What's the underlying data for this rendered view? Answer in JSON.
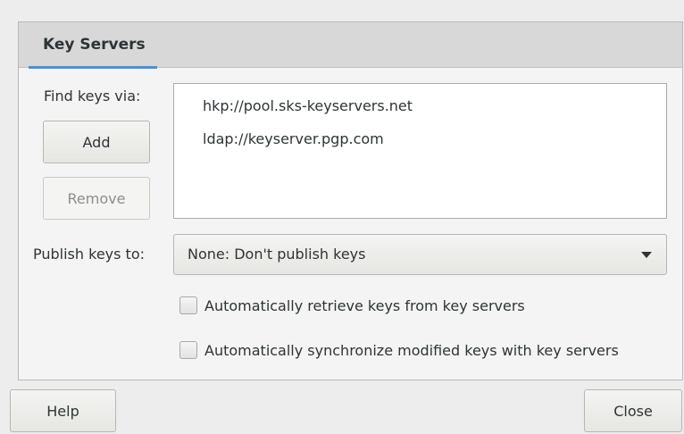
{
  "tab": {
    "label": "Key Servers"
  },
  "find_keys": {
    "label": "Find keys via:",
    "add_label": "Add",
    "remove_label": "Remove"
  },
  "servers": [
    "hkp://pool.sks-keyservers.net",
    "ldap://keyserver.pgp.com"
  ],
  "publish": {
    "label": "Publish keys to:",
    "selected": "None: Don't publish keys"
  },
  "options": {
    "auto_retrieve": {
      "label": "Automatically retrieve keys from key servers",
      "checked": false
    },
    "auto_sync": {
      "label": "Automatically synchronize modified keys with key servers",
      "checked": false
    }
  },
  "footer": {
    "help_label": "Help",
    "close_label": "Close"
  }
}
